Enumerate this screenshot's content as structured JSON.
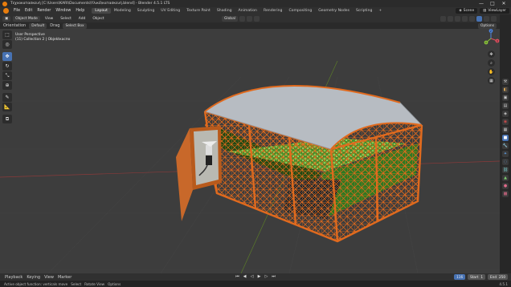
{
  "window": {
    "title": "Τεχνοκατασκευή [C:\\Users\\KARI\\Documents\\Υλικό\\κατασκευή.blend] - Blender 4.5.1 LTS",
    "minimize_glyph": "—",
    "maximize_glyph": "□",
    "close_glyph": "✕"
  },
  "menubar": {
    "menus": [
      "File",
      "Edit",
      "Render",
      "Window",
      "Help"
    ],
    "workspaces": [
      "Layout",
      "Modeling",
      "Sculpting",
      "UV Editing",
      "Texture Paint",
      "Shading",
      "Animation",
      "Rendering",
      "Compositing",
      "Geometry Nodes",
      "Scripting",
      "+"
    ],
    "active_workspace": "Layout",
    "scene": "Scene",
    "view_layer": "ViewLayer"
  },
  "header": {
    "editor_type": "▣",
    "mode": "Object Mode",
    "menus": [
      "View",
      "Select",
      "Add",
      "Object"
    ],
    "orientation": "Global",
    "options": "Options"
  },
  "tool_settings": {
    "orientation_label": "Orientation",
    "orientation_value": "Default",
    "drag_label": "Drag",
    "drag_value": "Select Box"
  },
  "viewport": {
    "view_name": "User Perspective",
    "collection": "(11) Collection 2 | Objektкаспо",
    "gizmo_axes": {
      "x": "X",
      "y": "Y",
      "z": "Z"
    },
    "nav_glyphs": [
      "✥",
      "⌕",
      "✋",
      "▦"
    ]
  },
  "toolbar": {
    "tools": [
      {
        "name": "select-box-tool",
        "glyph": "⬚"
      },
      {
        "name": "cursor-tool",
        "glyph": "◎"
      },
      {
        "name": "move-tool",
        "glyph": "✥"
      },
      {
        "name": "rotate-tool",
        "glyph": "↻"
      },
      {
        "name": "scale-tool",
        "glyph": "⤡"
      },
      {
        "name": "transform-tool",
        "glyph": "⊕"
      },
      {
        "name": "annotate-tool",
        "glyph": "✎"
      },
      {
        "name": "measure-tool",
        "glyph": "📐"
      },
      {
        "name": "add-cube-tool",
        "glyph": "⧉"
      }
    ]
  },
  "timeline": {
    "menus": [
      "Playback",
      "Keying",
      "View",
      "Marker"
    ],
    "play_glyphs": [
      "⏮",
      "◀",
      "◁",
      "▶",
      "▷",
      "⏭"
    ],
    "current_frame": "116",
    "start_label": "Start",
    "start_value": "1",
    "end_label": "End",
    "end_value": "250"
  },
  "status": {
    "items": [
      "Active object function: verticals move",
      "Select",
      "Rotate View",
      "Options"
    ],
    "version": "4.5.1"
  },
  "colors": {
    "accent": "#4772b3",
    "blender_orange": "#e87d0d",
    "frame_orange": "#e06a1e",
    "viewport_bg": "#3d3d3d"
  }
}
